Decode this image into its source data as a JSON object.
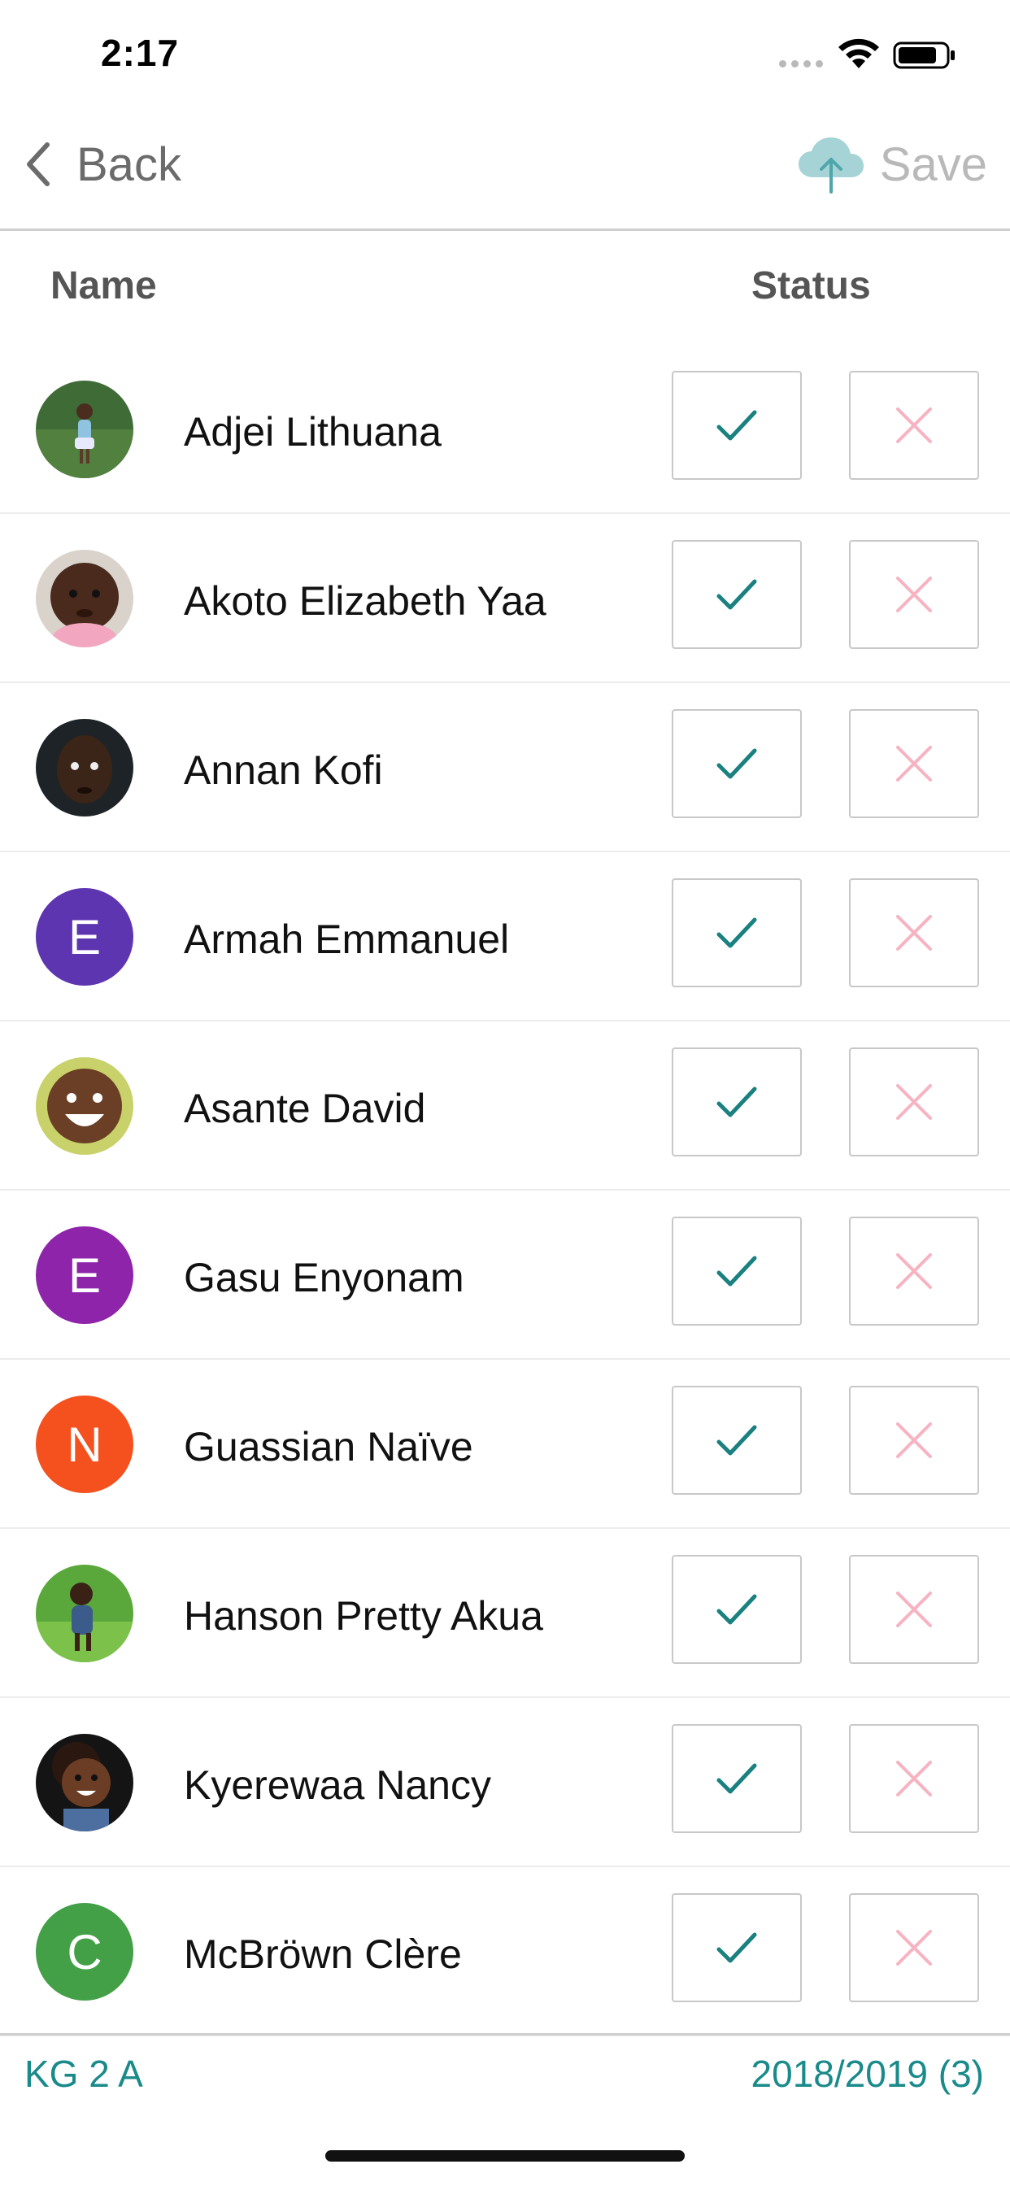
{
  "status_bar": {
    "time": "2:17"
  },
  "nav": {
    "back_label": "Back",
    "save_label": "Save"
  },
  "header": {
    "name_col": "Name",
    "status_col": "Status"
  },
  "students": [
    {
      "name": "Adjei Lithuana",
      "avatar": "photo",
      "initial": ""
    },
    {
      "name": "Akoto Elizabeth Yaa",
      "avatar": "photo",
      "initial": ""
    },
    {
      "name": "Annan Kofi",
      "avatar": "photo",
      "initial": ""
    },
    {
      "name": "Armah Emmanuel",
      "avatar": "initial",
      "initial": "E",
      "color": "#5e35b1"
    },
    {
      "name": "Asante David",
      "avatar": "photo",
      "initial": ""
    },
    {
      "name": "Gasu Enyonam",
      "avatar": "initial",
      "initial": "E",
      "color": "#8e24aa"
    },
    {
      "name": "Guassian Naïve",
      "avatar": "initial",
      "initial": "N",
      "color": "#f4511e"
    },
    {
      "name": "Hanson Pretty Akua",
      "avatar": "photo",
      "initial": ""
    },
    {
      "name": "Kyerewaa Nancy",
      "avatar": "photo",
      "initial": ""
    },
    {
      "name": "McBröwn Clère",
      "avatar": "initial",
      "initial": "C",
      "color": "#43a047"
    }
  ],
  "footer": {
    "class_name": "KG 2 A",
    "term": "2018/2019 (3)"
  },
  "colors": {
    "accent": "#1a8a8a",
    "present_check": "#1a8080",
    "absent_x": "#f7b3c2"
  }
}
